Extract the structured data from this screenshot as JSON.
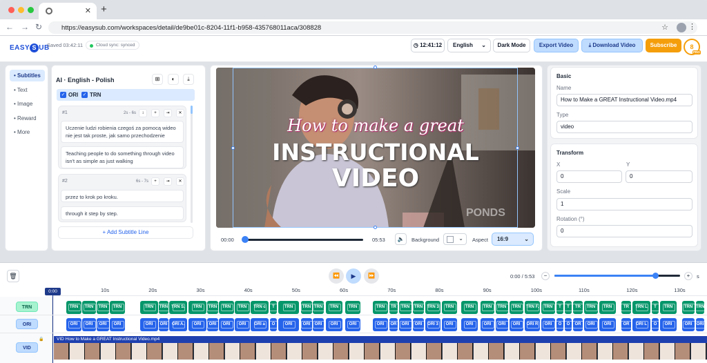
{
  "browser": {
    "url": "https://easysub.com/workspaces/detail/de9be01c-8204-11f1-b958-435768011aca/308828",
    "icons": [
      "back-icon",
      "forward-icon",
      "reload-icon",
      "star-icon",
      "profile-icon",
      "menu-icon"
    ],
    "window_dots": [
      "#ff5f57",
      "#febc2e",
      "#28c840"
    ]
  },
  "header": {
    "logo_prefix": "EASY",
    "logo_badge": "S",
    "logo_suffix": "UB",
    "saved": "Saved 03:42:11",
    "sync": "Cloud sync: synced",
    "timer": "12:41:12",
    "language": "English",
    "dark_mode": "Dark Mode",
    "export": "Export Video",
    "download": "Download Video",
    "subscribe": "Subscribe",
    "credits": "8",
    "pro": "PRO"
  },
  "sidebar": {
    "items": [
      {
        "label": "Subtitles",
        "active": true
      },
      {
        "label": "Text",
        "active": false
      },
      {
        "label": "Image",
        "active": false
      },
      {
        "label": "Reward",
        "active": false
      },
      {
        "label": "More",
        "active": false
      }
    ]
  },
  "subtitles": {
    "title": "AI · English - Polish",
    "filters": [
      "ORI",
      "TRN"
    ],
    "cards": [
      {
        "num": "#1",
        "time": "2s - 6s",
        "ori": "Uczenie ludzi robienia czegoś za pomocą wideo nie jest tak proste, jak samo przechodzenie",
        "trn": "Teaching people to do something through video isn't as simple as just walking"
      },
      {
        "num": "#2",
        "time": "6s - 7s",
        "ori": "przez to krok po kroku.",
        "trn": "through it step by step."
      }
    ],
    "add_line": "+ Add Subtitle Line"
  },
  "video": {
    "script_line": "How to make a great",
    "line2": "INSTRUCTIONAL",
    "line3": "VIDEO",
    "watermark": "PONDS",
    "time_current": "00:00",
    "time_total": "05:53",
    "progress": 0.0,
    "background_label": "Background",
    "aspect_label": "Aspect",
    "aspect": "16:9"
  },
  "properties": {
    "basic_title": "Basic",
    "name_label": "Name",
    "name": "How to Make a GREAT Instructional Video.mp4",
    "type_label": "Type",
    "type": "video",
    "transform_title": "Transform",
    "x_label": "X",
    "x": "0",
    "y_label": "Y",
    "y": "0",
    "scale_label": "Scale",
    "scale": "1",
    "rotation_label": "Rotation (°)",
    "rotation": "0"
  },
  "timeline": {
    "time": "0:00 / 5:53",
    "zoom_unit": "s",
    "zoom_level": 0.8,
    "playhead": "0:00",
    "ruler": [
      "10s",
      "20s",
      "30s",
      "40s",
      "50s",
      "60s",
      "70s",
      "80s",
      "90s",
      "100s",
      "110s",
      "120s",
      "130s"
    ],
    "tracks": {
      "trn": "TRN",
      "ori": "ORI",
      "vid": "VID"
    },
    "vid_clip": "VID  How to Make a GREAT Instructional Video.mp4",
    "colors": {
      "trn": "#059669",
      "ori": "#2563eb",
      "vid": "#1e40af"
    },
    "clips": [
      {
        "start": 96,
        "width": 22,
        "trn": "TRN",
        "ori": "ORI"
      },
      {
        "start": 119,
        "width": 20,
        "trn": "TRN",
        "ori": "ORI"
      },
      {
        "start": 140,
        "width": 18,
        "trn": "TRN",
        "ori": "ORI"
      },
      {
        "start": 159,
        "width": 22,
        "trn": "TRN",
        "ori": "ORI"
      },
      {
        "start": 203,
        "width": 26,
        "trn": "TRN",
        "ori": "ORI"
      },
      {
        "start": 230,
        "width": 14,
        "trn": "TRN",
        "ori": "ORI"
      },
      {
        "start": 245,
        "width": 26,
        "trn": "TRN S.",
        "ori": "ORI A."
      },
      {
        "start": 273,
        "width": 26,
        "trn": "TRN",
        "ori": "ORI"
      },
      {
        "start": 300,
        "width": 16,
        "trn": "TRN",
        "ori": "ORI"
      },
      {
        "start": 317,
        "width": 22,
        "trn": "TRN",
        "ori": "ORI"
      },
      {
        "start": 340,
        "width": 22,
        "trn": "TRN",
        "ori": "ORI"
      },
      {
        "start": 363,
        "width": 26,
        "trn": "TRN c",
        "ori": "ORI a"
      },
      {
        "start": 391,
        "width": 10,
        "trn": "T",
        "ori": "O"
      },
      {
        "start": 403,
        "width": 30,
        "trn": "TRN",
        "ori": "ORI"
      },
      {
        "start": 436,
        "width": 16,
        "trn": "TRN",
        "ori": "ORI"
      },
      {
        "start": 453,
        "width": 16,
        "trn": "TRN",
        "ori": "ORI"
      },
      {
        "start": 472,
        "width": 24,
        "trn": "TRN",
        "ori": "ORI"
      },
      {
        "start": 500,
        "width": 22,
        "trn": "TRN",
        "ori": "ORI"
      },
      {
        "start": 540,
        "width": 22,
        "trn": "TRN",
        "ori": "ORI"
      },
      {
        "start": 564,
        "width": 12,
        "trn": "TR",
        "ori": "OR"
      },
      {
        "start": 578,
        "width": 18,
        "trn": "TRN",
        "ori": "ORI"
      },
      {
        "start": 598,
        "width": 16,
        "trn": "TRN",
        "ori": "ORI"
      },
      {
        "start": 616,
        "width": 22,
        "trn": "TRN 3",
        "ori": "ORI 3"
      },
      {
        "start": 640,
        "width": 22,
        "trn": "TRN",
        "ori": "ORI"
      },
      {
        "start": 668,
        "width": 24,
        "trn": "TRN",
        "ori": "ORI"
      },
      {
        "start": 696,
        "width": 20,
        "trn": "TRN",
        "ori": "ORI"
      },
      {
        "start": 718,
        "width": 18,
        "trn": "TRN",
        "ori": "ORI"
      },
      {
        "start": 738,
        "width": 20,
        "trn": "TRN",
        "ori": "ORI"
      },
      {
        "start": 760,
        "width": 22,
        "trn": "TRN F.",
        "ori": "ORI R"
      },
      {
        "start": 784,
        "width": 20,
        "trn": "TRN",
        "ori": "ORI"
      },
      {
        "start": 806,
        "width": 10,
        "trn": "T",
        "ori": "O"
      },
      {
        "start": 818,
        "width": 10,
        "trn": "T",
        "ori": "O"
      },
      {
        "start": 830,
        "width": 14,
        "trn": "TR",
        "ori": "OR"
      },
      {
        "start": 846,
        "width": 20,
        "trn": "TRN",
        "ori": "ORI"
      },
      {
        "start": 868,
        "width": 24,
        "trn": "TRN",
        "ori": "ORI"
      },
      {
        "start": 900,
        "width": 14,
        "trn": "TR",
        "ori": "OR"
      },
      {
        "start": 916,
        "width": 26,
        "trn": "TRN L",
        "ori": "ORI L"
      },
      {
        "start": 944,
        "width": 10,
        "trn": "T",
        "ori": "O"
      },
      {
        "start": 956,
        "width": 24,
        "trn": "TRN",
        "ori": "ORI"
      },
      {
        "start": 988,
        "width": 18,
        "trn": "TRN",
        "ori": "ORI"
      },
      {
        "start": 1008,
        "width": 12,
        "trn": "TRN",
        "ori": "ORI"
      }
    ]
  }
}
